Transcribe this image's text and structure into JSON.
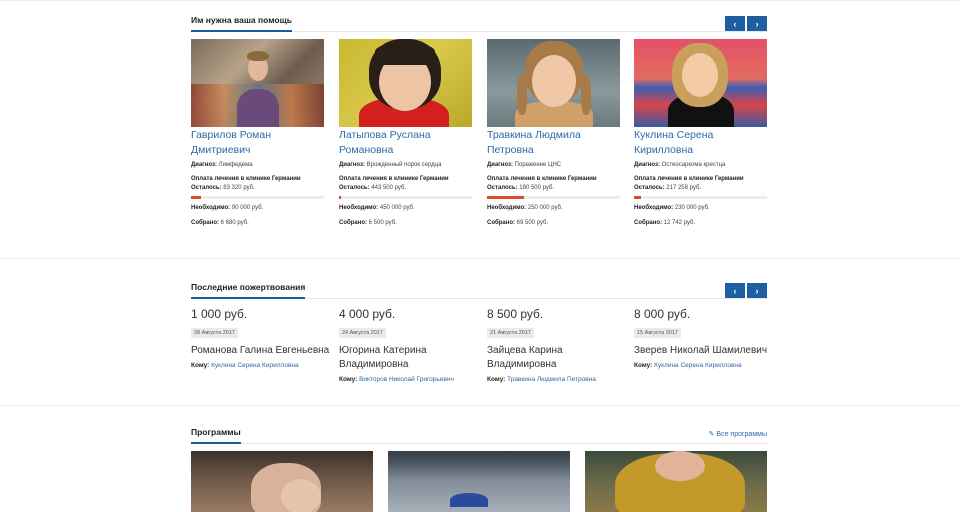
{
  "needs_help": {
    "title": "Им нужна ваша помощь",
    "nav_prev": "‹",
    "nav_next": "›",
    "cards": [
      {
        "name": "Гаврилов Роман Дмитриевич",
        "diagnosis_label": "Диагноз:",
        "diagnosis": "Лимфедема",
        "treatment": "Оплата лечения в клинике Германии",
        "remaining_label": "Осталось:",
        "remaining": "83 320 руб.",
        "progress": 0.074,
        "needed_label": "Необходимо:",
        "needed": "90 000 руб.",
        "collected_label": "Собрано:",
        "collected": "6 680 руб."
      },
      {
        "name": "Латыпова Руслана Романовна",
        "diagnosis_label": "Диагноз:",
        "diagnosis": "Врожденный порок сердца",
        "treatment": "Оплата лечения в клинике Германии",
        "remaining_label": "Осталось:",
        "remaining": "443 500 руб.",
        "progress": 0.014,
        "needed_label": "Необходимо:",
        "needed": "450 000 руб.",
        "collected_label": "Собрано:",
        "collected": "6 500 руб."
      },
      {
        "name": "Травкина Людмила Петровна",
        "diagnosis_label": "Диагноз:",
        "diagnosis": "Поражение ЦНС",
        "treatment": "Оплата лечения в клинике Германии",
        "remaining_label": "Осталось:",
        "remaining": "180 500 руб.",
        "progress": 0.278,
        "needed_label": "Необходимо:",
        "needed": "250 000 руб.",
        "collected_label": "Собрано:",
        "collected": "69 500 руб."
      },
      {
        "name": "Куклина Серена Кирилловна",
        "diagnosis_label": "Диагноз:",
        "diagnosis": "Остеосаркома крестца",
        "treatment": "Оплата лечения в клинике Германии",
        "remaining_label": "Осталось:",
        "remaining": "217 258 руб.",
        "progress": 0.055,
        "needed_label": "Необходимо:",
        "needed": "230 000 руб.",
        "collected_label": "Собрано:",
        "collected": "12 742 руб."
      }
    ]
  },
  "donations": {
    "title": "Последние пожертвования",
    "nav_prev": "‹",
    "nav_next": "›",
    "items": [
      {
        "amount": "1 000 руб.",
        "date": "28 Августа 2017",
        "donor": "Романова Галина Евгеньевна",
        "to_label": "Кому:",
        "to": "Куклина Серена Кирилловна"
      },
      {
        "amount": "4 000 руб.",
        "date": "24 Августа 2017",
        "donor": "Югорина Катерина Владимировна",
        "to_label": "Кому:",
        "to": "Викторов Николай Григорьевич"
      },
      {
        "amount": "8 500 руб.",
        "date": "21 Августа 2017",
        "donor": "Зайцева Карина Владимировна",
        "to_label": "Кому:",
        "to": "Травкина Людмила Петровна"
      },
      {
        "amount": "8 000 руб.",
        "date": "15 Августа 2017",
        "donor": "Зверев Николай Шамилевич",
        "to_label": "Кому:",
        "to": "Куклина Серена Кирилловна"
      }
    ]
  },
  "programs": {
    "title": "Программы",
    "all_link": "Все программы",
    "link_icon": "tag-icon"
  },
  "colors": {
    "accent": "#1d5fa1",
    "link": "#2a6aa8",
    "progress": "#e0482e"
  }
}
